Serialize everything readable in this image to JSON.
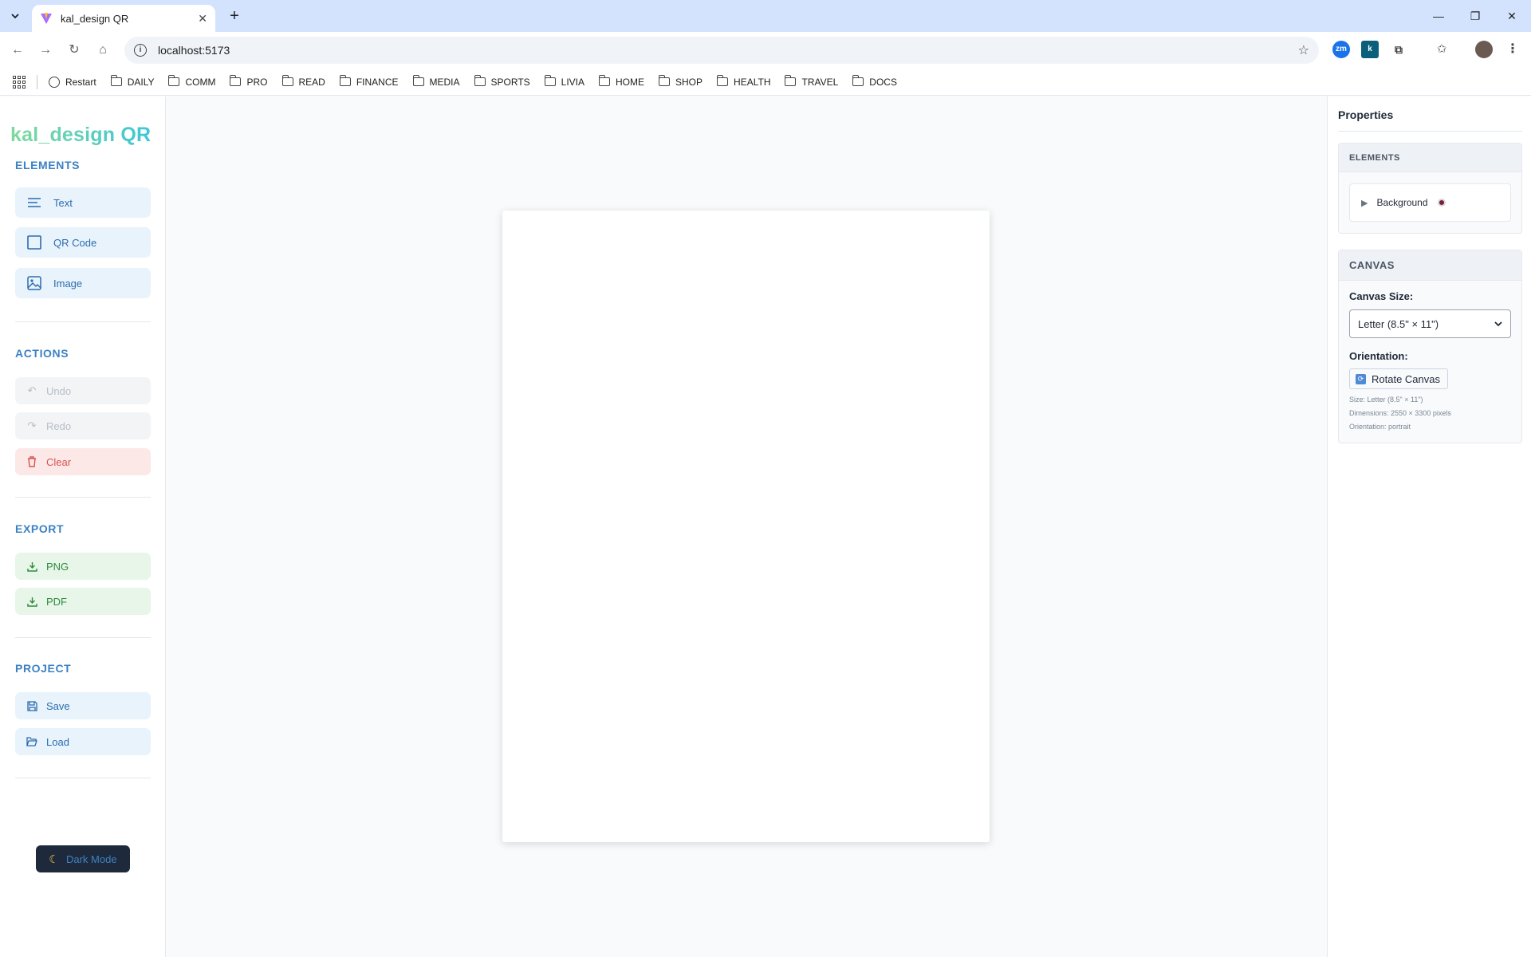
{
  "browser": {
    "tab_title": "kal_design QR",
    "url": "localhost:5173",
    "bookmarks": [
      "Restart",
      "DAILY",
      "COMM",
      "PRO",
      "READ",
      "FINANCE",
      "MEDIA",
      "SPORTS",
      "LIVIA",
      "HOME",
      "SHOP",
      "HEALTH",
      "TRAVEL",
      "DOCS"
    ]
  },
  "sidebar": {
    "logo": "kal_design QR",
    "elements": {
      "heading": "ELEMENTS",
      "text": "Text",
      "qr": "QR Code",
      "image": "Image"
    },
    "actions": {
      "heading": "ACTIONS",
      "undo": "Undo",
      "redo": "Redo",
      "clear": "Clear"
    },
    "export": {
      "heading": "EXPORT",
      "png": "PNG",
      "pdf": "PDF"
    },
    "project": {
      "heading": "PROJECT",
      "save": "Save",
      "load": "Load"
    },
    "dark_mode": "Dark Mode"
  },
  "properties": {
    "title": "Properties",
    "elements_heading": "ELEMENTS",
    "background_item": "Background",
    "background_color": "#7a1f3a",
    "canvas_heading": "CANVAS",
    "canvas_size_label": "Canvas Size:",
    "canvas_size_value": "Letter (8.5\" × 11\")",
    "orientation_label": "Orientation:",
    "rotate_button": "Rotate Canvas",
    "info_size": "Size: Letter (8.5\" × 11\")",
    "info_dimensions": "Dimensions: 2550 × 3300 pixels",
    "info_orientation": "Orientation: portrait"
  },
  "colors": {
    "accent": "#3b82c4",
    "danger": "#d9534f",
    "success": "#2e8b3d"
  }
}
